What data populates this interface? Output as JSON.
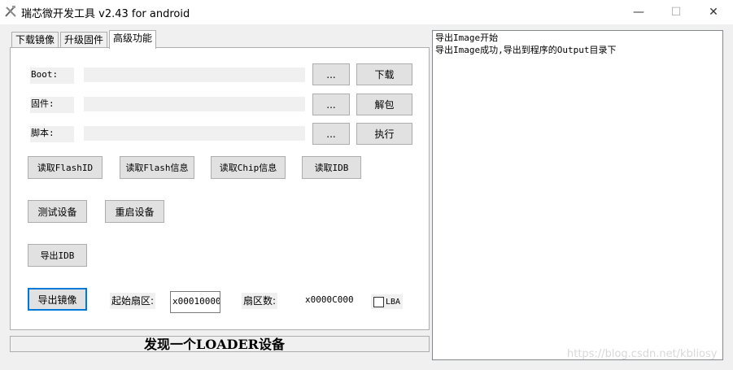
{
  "window": {
    "title": "瑞芯微开发工具 v2.43 for android",
    "minimize": "—",
    "maximize": "☐",
    "close": "✕"
  },
  "tabs": [
    {
      "label": "下载镜像",
      "active": false
    },
    {
      "label": "升级固件",
      "active": false
    },
    {
      "label": "高级功能",
      "active": true
    }
  ],
  "fields": {
    "boot": {
      "label": "Boot:",
      "value": "",
      "browse": "...",
      "action": "下载"
    },
    "firmware": {
      "label": "固件:",
      "value": "",
      "browse": "...",
      "action": "解包"
    },
    "script": {
      "label": "脚本:",
      "value": "",
      "browse": "...",
      "action": "执行"
    }
  },
  "buttons": {
    "read_flash_id": "读取FlashID",
    "read_flash_info": "读取Flash信息",
    "read_chip_info": "读取Chip信息",
    "read_idb": "读取IDB",
    "test_device": "测试设备",
    "restart_device": "重启设备",
    "export_idb": "导出IDB",
    "export_image": "导出镜像"
  },
  "export": {
    "start_sector_label": "起始扇区:",
    "start_sector_value": "x00010000",
    "sector_count_label": "扇区数:",
    "sector_count_value": "x0000C000",
    "lba_label": "LBA",
    "lba_checked": false
  },
  "status": {
    "text": "发现一个LOADER设备"
  },
  "log": {
    "lines": [
      "导出Image开始",
      "导出Image成功,导出到程序的Output目录下"
    ]
  },
  "watermark": "https://blog.csdn.net/kbliosy"
}
